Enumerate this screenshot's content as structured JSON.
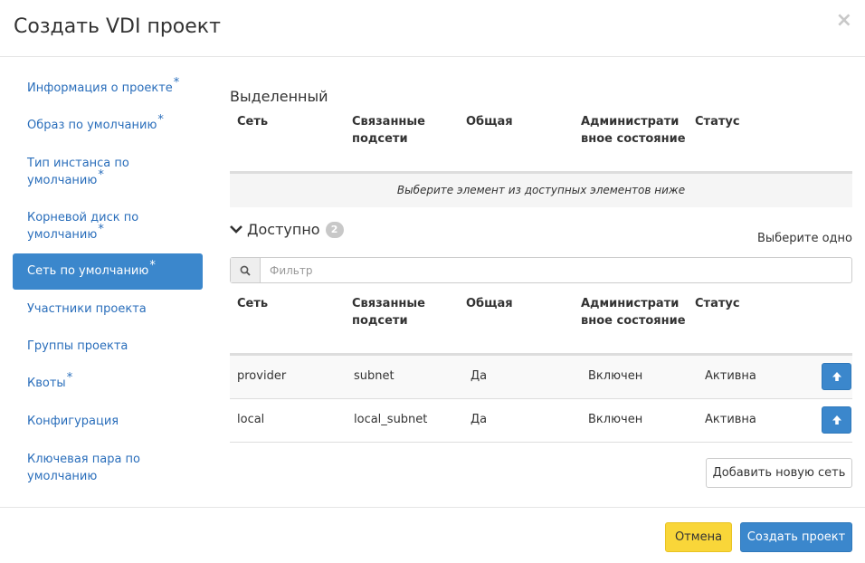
{
  "dialog": {
    "title": "Создать VDI проект",
    "close_symbol": "×"
  },
  "sidebar": {
    "items": [
      {
        "label": "Информация о проекте",
        "required": "*"
      },
      {
        "label": "Образ по умолчанию",
        "required": "*"
      },
      {
        "label_line1": "Тип инстанса по",
        "label_line2": "умолчанию",
        "required": "*"
      },
      {
        "label_line1": "Корневой диск по",
        "label_line2": "умолчанию",
        "required": "*"
      },
      {
        "label": "Сеть по умолчанию",
        "required": "*",
        "active": true
      },
      {
        "label": "Участники проекта"
      },
      {
        "label": "Группы проекта"
      },
      {
        "label": "Квоты",
        "required": "*"
      },
      {
        "label": "Конфигурация"
      },
      {
        "label_line1": "Ключевая пара по",
        "label_line2": "умолчанию"
      }
    ]
  },
  "allocated": {
    "title": "Выделенный",
    "empty_message": "Выберите элемент из доступных элементов ниже"
  },
  "columns": {
    "network": "Сеть",
    "subnets_line1": "Связанные",
    "subnets_line2": "подсети",
    "shared": "Общая",
    "admin_line1": "Администрати",
    "admin_line2": "вное состояние",
    "status": "Статус"
  },
  "available": {
    "title": "Доступно",
    "count": "2",
    "select_one": "Выберите одно",
    "filter_placeholder": "Фильтр",
    "rows": [
      {
        "network": "provider",
        "subnets": "subnet",
        "shared": "Да",
        "admin": "Включен",
        "status": "Активна"
      },
      {
        "network": "local",
        "subnets": "local_subnet",
        "shared": "Да",
        "admin": "Включен",
        "status": "Активна"
      }
    ]
  },
  "buttons": {
    "add_network": "Добавить новую сеть",
    "cancel": "Отмена",
    "create": "Создать проект"
  },
  "colors": {
    "accent": "#3b87cc",
    "link": "#2a6ebb",
    "cancel": "#f9d639"
  }
}
